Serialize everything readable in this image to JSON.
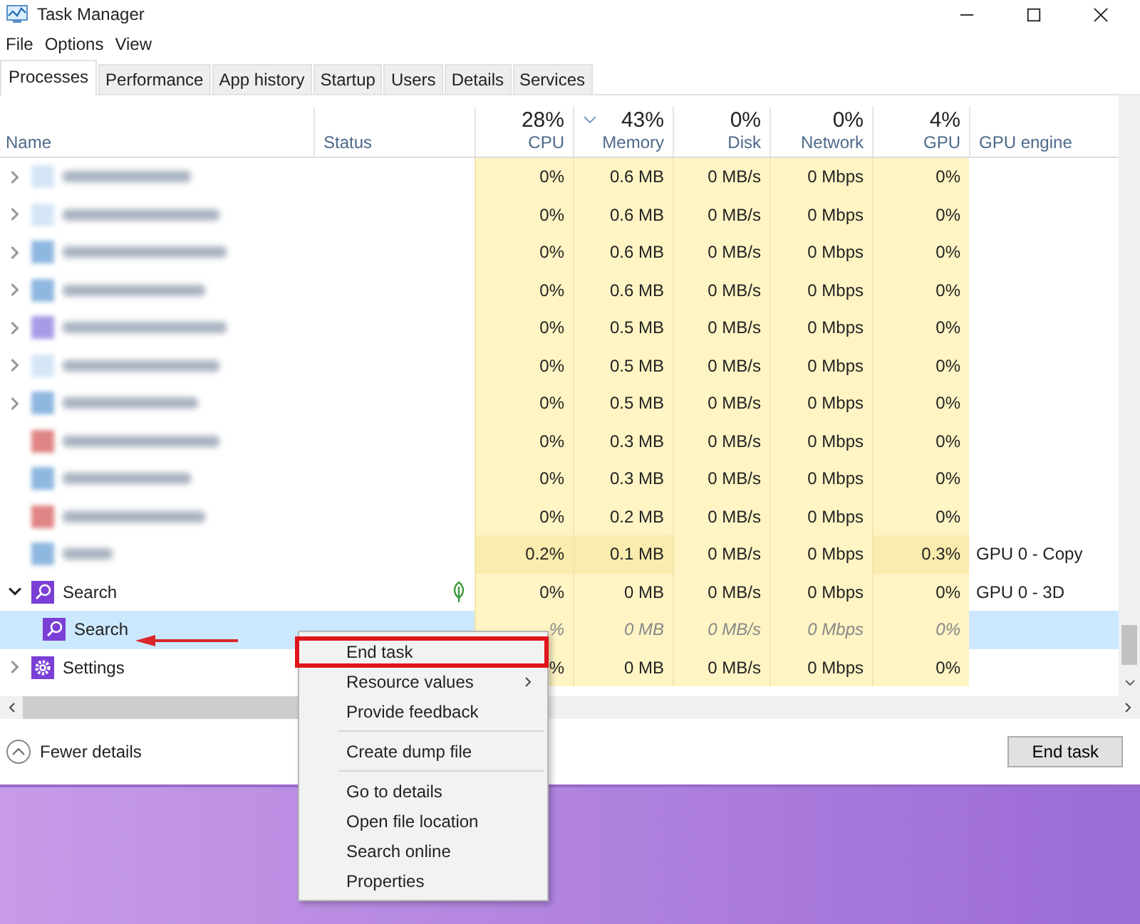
{
  "window": {
    "title": "Task Manager"
  },
  "menu": [
    "File",
    "Options",
    "View"
  ],
  "tabs": [
    {
      "label": "Processes",
      "selected": true
    },
    {
      "label": "Performance",
      "selected": false
    },
    {
      "label": "App history",
      "selected": false
    },
    {
      "label": "Startup",
      "selected": false
    },
    {
      "label": "Users",
      "selected": false
    },
    {
      "label": "Details",
      "selected": false
    },
    {
      "label": "Services",
      "selected": false
    }
  ],
  "columns": [
    {
      "label": "Name"
    },
    {
      "label": "Status"
    },
    {
      "label": "CPU",
      "total": "28%",
      "sorted": false
    },
    {
      "label": "Memory",
      "total": "43%",
      "sorted": true
    },
    {
      "label": "Disk",
      "total": "0%",
      "sorted": false
    },
    {
      "label": "Network",
      "total": "0%",
      "sorted": false
    },
    {
      "label": "GPU",
      "total": "4%",
      "sorted": false
    },
    {
      "label": "GPU engine"
    }
  ],
  "rows": [
    {
      "kind": "blurred",
      "expandable": true,
      "selected": false,
      "color": "#d6e6f7",
      "cells": [
        {
          "text": "0%",
          "hot": false
        },
        {
          "text": "0.6 MB",
          "hot": false
        },
        {
          "text": "0 MB/s",
          "hot": false
        },
        {
          "text": "0 Mbps",
          "hot": false
        },
        {
          "text": "0%",
          "hot": false
        }
      ]
    },
    {
      "kind": "blurred",
      "expandable": true,
      "selected": false,
      "color": "#d6e6f7",
      "cells": [
        {
          "text": "0%",
          "hot": false
        },
        {
          "text": "0.6 MB",
          "hot": false
        },
        {
          "text": "0 MB/s",
          "hot": false
        },
        {
          "text": "0 Mbps",
          "hot": false
        },
        {
          "text": "0%",
          "hot": false
        }
      ]
    },
    {
      "kind": "blurred",
      "expandable": true,
      "selected": false,
      "color": "#8fb8e0",
      "cells": [
        {
          "text": "0%",
          "hot": false
        },
        {
          "text": "0.6 MB",
          "hot": false
        },
        {
          "text": "0 MB/s",
          "hot": false
        },
        {
          "text": "0 Mbps",
          "hot": false
        },
        {
          "text": "0%",
          "hot": false
        }
      ]
    },
    {
      "kind": "blurred",
      "expandable": true,
      "selected": false,
      "color": "#8fb8e0",
      "cells": [
        {
          "text": "0%",
          "hot": false
        },
        {
          "text": "0.6 MB",
          "hot": false
        },
        {
          "text": "0 MB/s",
          "hot": false
        },
        {
          "text": "0 Mbps",
          "hot": false
        },
        {
          "text": "0%",
          "hot": false
        }
      ]
    },
    {
      "kind": "blurred",
      "expandable": true,
      "selected": false,
      "color": "#a79be6",
      "cells": [
        {
          "text": "0%",
          "hot": false
        },
        {
          "text": "0.5 MB",
          "hot": false
        },
        {
          "text": "0 MB/s",
          "hot": false
        },
        {
          "text": "0 Mbps",
          "hot": false
        },
        {
          "text": "0%",
          "hot": false
        }
      ]
    },
    {
      "kind": "blurred",
      "expandable": true,
      "selected": false,
      "color": "#d6e6f7",
      "cells": [
        {
          "text": "0%",
          "hot": false
        },
        {
          "text": "0.5 MB",
          "hot": false
        },
        {
          "text": "0 MB/s",
          "hot": false
        },
        {
          "text": "0 Mbps",
          "hot": false
        },
        {
          "text": "0%",
          "hot": false
        }
      ]
    },
    {
      "kind": "blurred",
      "expandable": true,
      "selected": false,
      "color": "#8fb8e0",
      "cells": [
        {
          "text": "0%",
          "hot": false
        },
        {
          "text": "0.5 MB",
          "hot": false
        },
        {
          "text": "0 MB/s",
          "hot": false
        },
        {
          "text": "0 Mbps",
          "hot": false
        },
        {
          "text": "0%",
          "hot": false
        }
      ]
    },
    {
      "kind": "blurred",
      "expandable": false,
      "selected": false,
      "color": "#e08585",
      "cells": [
        {
          "text": "0%",
          "hot": false
        },
        {
          "text": "0.3 MB",
          "hot": false
        },
        {
          "text": "0 MB/s",
          "hot": false
        },
        {
          "text": "0 Mbps",
          "hot": false
        },
        {
          "text": "0%",
          "hot": false
        }
      ]
    },
    {
      "kind": "blurred",
      "expandable": false,
      "selected": false,
      "color": "#8fb8e0",
      "cells": [
        {
          "text": "0%",
          "hot": false
        },
        {
          "text": "0.3 MB",
          "hot": false
        },
        {
          "text": "0 MB/s",
          "hot": false
        },
        {
          "text": "0 Mbps",
          "hot": false
        },
        {
          "text": "0%",
          "hot": false
        }
      ]
    },
    {
      "kind": "blurred",
      "expandable": false,
      "selected": false,
      "color": "#e08585",
      "cells": [
        {
          "text": "0%",
          "hot": false
        },
        {
          "text": "0.2 MB",
          "hot": false
        },
        {
          "text": "0 MB/s",
          "hot": false
        },
        {
          "text": "0 Mbps",
          "hot": false
        },
        {
          "text": "0%",
          "hot": false
        }
      ]
    },
    {
      "kind": "blurred",
      "expandable": false,
      "selected": false,
      "color": "#8fb8e0",
      "cells": [
        {
          "text": "0.2%",
          "hot": true
        },
        {
          "text": "0.1 MB",
          "hot": true
        },
        {
          "text": "0 MB/s",
          "hot": false
        },
        {
          "text": "0 Mbps",
          "hot": false
        },
        {
          "text": "0.3%",
          "hot": true
        }
      ],
      "gpu_engine": "GPU 0 - Copy"
    },
    {
      "kind": "search",
      "name": "Search",
      "expandable": true,
      "expanded": true,
      "selected": false,
      "leaf": true,
      "cells": [
        {
          "text": "0%",
          "hot": false
        },
        {
          "text": "0 MB",
          "hot": false
        },
        {
          "text": "0 MB/s",
          "hot": false
        },
        {
          "text": "0 Mbps",
          "hot": false
        },
        {
          "text": "0%",
          "hot": false
        }
      ],
      "gpu_engine": "GPU 0 - 3D",
      "children": [
        {
          "kind": "search",
          "name": "Search",
          "selected": true,
          "cells": [
            {
              "text": "%",
              "hot": false
            },
            {
              "text": "0 MB",
              "hot": false
            },
            {
              "text": "0 MB/s",
              "hot": false
            },
            {
              "text": "0 Mbps",
              "hot": false
            },
            {
              "text": "0%",
              "hot": false
            }
          ]
        }
      ]
    },
    {
      "kind": "gear",
      "name": "Settings",
      "expandable": true,
      "selected": false,
      "cells": [
        {
          "text": "%",
          "hot": false
        },
        {
          "text": "0 MB",
          "hot": false
        },
        {
          "text": "0 MB/s",
          "hot": false
        },
        {
          "text": "0 Mbps",
          "hot": false
        },
        {
          "text": "0%",
          "hot": false
        }
      ]
    }
  ],
  "footer": {
    "toggle": "Fewer details",
    "button": "End task"
  },
  "context_menu": [
    {
      "kind": "item",
      "label": "End task",
      "highlighted": true
    },
    {
      "kind": "submenu",
      "label": "Resource values",
      "highlighted": false
    },
    {
      "kind": "item",
      "label": "Provide feedback",
      "highlighted": false
    },
    {
      "kind": "separator"
    },
    {
      "kind": "item",
      "label": "Create dump file",
      "highlighted": false
    },
    {
      "kind": "separator"
    },
    {
      "kind": "item",
      "label": "Go to details",
      "highlighted": false
    },
    {
      "kind": "item",
      "label": "Open file location",
      "highlighted": false
    },
    {
      "kind": "item",
      "label": "Search online",
      "highlighted": false
    },
    {
      "kind": "item",
      "label": "Properties",
      "highlighted": false
    }
  ]
}
